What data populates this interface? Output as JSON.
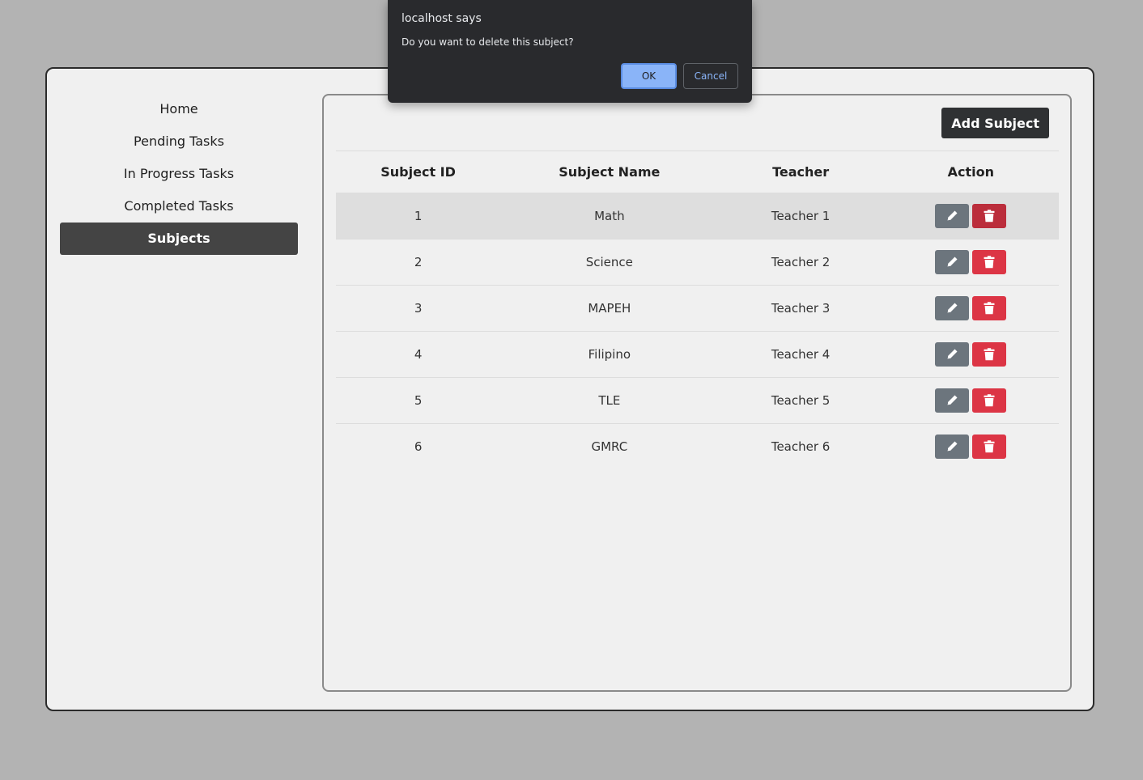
{
  "sidebar": {
    "items": [
      {
        "label": "Home",
        "active": false
      },
      {
        "label": "Pending Tasks",
        "active": false
      },
      {
        "label": "In Progress Tasks",
        "active": false
      },
      {
        "label": "Completed Tasks",
        "active": false
      },
      {
        "label": "Subjects",
        "active": true
      }
    ]
  },
  "main": {
    "add_button_label": "Add Subject",
    "table": {
      "headers": [
        "Subject ID",
        "Subject Name",
        "Teacher",
        "Action"
      ],
      "rows": [
        {
          "id": "1",
          "name": "Math",
          "teacher": "Teacher 1"
        },
        {
          "id": "2",
          "name": "Science",
          "teacher": "Teacher 2"
        },
        {
          "id": "3",
          "name": "MAPEH",
          "teacher": "Teacher 3"
        },
        {
          "id": "4",
          "name": "Filipino",
          "teacher": "Teacher 4"
        },
        {
          "id": "5",
          "name": "TLE",
          "teacher": "Teacher 5"
        },
        {
          "id": "6",
          "name": "GMRC",
          "teacher": "Teacher 6"
        }
      ],
      "action_icons": {
        "edit": "pencil-icon",
        "delete": "trash-icon"
      }
    }
  },
  "dialog": {
    "title": "localhost says",
    "message": "Do you want to delete this subject?",
    "ok_label": "OK",
    "cancel_label": "Cancel"
  },
  "colors": {
    "page_background": "#b3b3b3",
    "card_background": "#f0f0f0",
    "active_nav": "#444444",
    "edit_button": "#6c757d",
    "delete_button": "#dc3545",
    "dialog_background": "#292a2d",
    "dialog_accent": "#8ab4f8"
  }
}
